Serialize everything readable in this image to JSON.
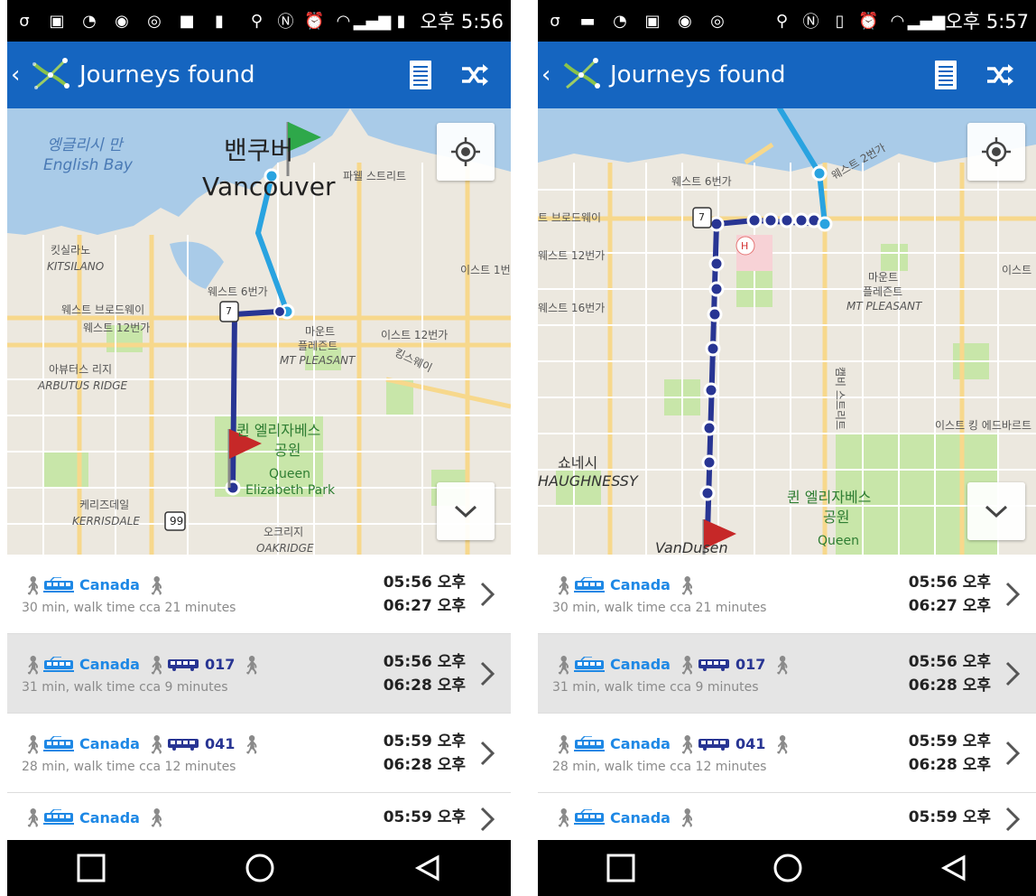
{
  "screens": [
    {
      "status": {
        "time": "오후 5:56"
      },
      "app": {
        "title": "Journeys found"
      },
      "map_labels": {
        "english_bay_kr": "엥글리시 만",
        "english_bay": "English Bay",
        "vancouver_kr": "밴쿠버",
        "vancouver": "Vancouver",
        "powell": "파웰 스트리트",
        "kitsilano_kr": "킷실라노",
        "kitsilano": "KITSILANO",
        "east1": "이스트 1번",
        "w6": "웨스트 6번가",
        "wbroad": "웨스트 브로드웨이",
        "w12": "웨스트 12번가",
        "mtp_kr1": "마운트",
        "mtp_kr2": "플레즌트",
        "mtp": "MT PLEASANT",
        "e12": "이스트 12번가",
        "kingsway": "킹스웨이",
        "arbutus_kr": "아뷰터스 리지",
        "arbutus": "ARBUTUS RIDGE",
        "qe_kr1": "퀸 엘리자베스",
        "qe_kr2": "공원",
        "qe1": "Queen",
        "qe2": "Elizabeth Park",
        "kerrisdale_kr": "케리즈데일",
        "kerrisdale": "KERRISDALE",
        "hwy99": "99",
        "oakridge_kr": "오크리지",
        "oakridge": "OAKRIDGE",
        "rt7": "7"
      },
      "journeys": [
        {
          "legs": [
            {
              "type": "walk"
            },
            {
              "type": "train",
              "label": "Canada"
            },
            {
              "type": "walk"
            }
          ],
          "summary": "30 min, walk time cca 21 minutes",
          "depart": "05:56 오후",
          "arrive": "06:27 오후"
        },
        {
          "legs": [
            {
              "type": "walk"
            },
            {
              "type": "train",
              "label": "Canada"
            },
            {
              "type": "walk"
            },
            {
              "type": "bus",
              "label": "017"
            },
            {
              "type": "walk"
            }
          ],
          "summary": "31 min, walk time cca 9 minutes",
          "depart": "05:56 오후",
          "arrive": "06:28 오후"
        },
        {
          "legs": [
            {
              "type": "walk"
            },
            {
              "type": "train",
              "label": "Canada"
            },
            {
              "type": "walk"
            },
            {
              "type": "bus",
              "label": "041"
            },
            {
              "type": "walk"
            }
          ],
          "summary": "28 min, walk time cca 12 minutes",
          "depart": "05:59 오후",
          "arrive": "06:28 오후"
        },
        {
          "legs": [
            {
              "type": "walk"
            },
            {
              "type": "train",
              "label": "Canada"
            },
            {
              "type": "walk"
            }
          ],
          "summary": "",
          "depart": "05:59 오후",
          "arrive": ""
        }
      ]
    },
    {
      "status": {
        "time": "오후 5:57"
      },
      "app": {
        "title": "Journeys found"
      },
      "map_labels": {
        "w6": "웨스트 6번가",
        "w2": "웨스트 2번가",
        "broad": "트 브로드웨이",
        "w12": "웨스트 12번가",
        "w16": "웨스트 16번가",
        "mtp_kr1": "마운트",
        "mtp_kr2": "플레즌트",
        "mtp": "MT PLEASANT",
        "east": "이스트",
        "cambie": "캠비 스트리트",
        "eking": "이스트 킹 에드바르트",
        "shaugh_kr": "쇼네시",
        "shaugh": "HAUGHNESSY",
        "qe_kr1": "퀸 엘리자베스",
        "qe_kr2": "공원",
        "qe1": "Queen",
        "vandusen": "VanDusen",
        "rt7": "7",
        "hosp": "H"
      },
      "journeys": [
        {
          "legs": [
            {
              "type": "walk"
            },
            {
              "type": "train",
              "label": "Canada"
            },
            {
              "type": "walk"
            }
          ],
          "summary": "30 min, walk time cca 21 minutes",
          "depart": "05:56 오후",
          "arrive": "06:27 오후"
        },
        {
          "legs": [
            {
              "type": "walk"
            },
            {
              "type": "train",
              "label": "Canada"
            },
            {
              "type": "walk"
            },
            {
              "type": "bus",
              "label": "017"
            },
            {
              "type": "walk"
            }
          ],
          "summary": "31 min, walk time cca 9 minutes",
          "depart": "05:56 오후",
          "arrive": "06:28 오후"
        },
        {
          "legs": [
            {
              "type": "walk"
            },
            {
              "type": "train",
              "label": "Canada"
            },
            {
              "type": "walk"
            },
            {
              "type": "bus",
              "label": "041"
            },
            {
              "type": "walk"
            }
          ],
          "summary": "28 min, walk time cca 12 minutes",
          "depart": "05:59 오후",
          "arrive": "06:28 오후"
        },
        {
          "legs": [
            {
              "type": "walk"
            },
            {
              "type": "train",
              "label": "Canada"
            },
            {
              "type": "walk"
            }
          ],
          "summary": "",
          "depart": "05:59 오후",
          "arrive": ""
        }
      ]
    }
  ],
  "colors": {
    "appbar": "#1565c0",
    "walk_route": "#29a3e0",
    "transit_route": "#283593",
    "train": "#1e88e5"
  }
}
